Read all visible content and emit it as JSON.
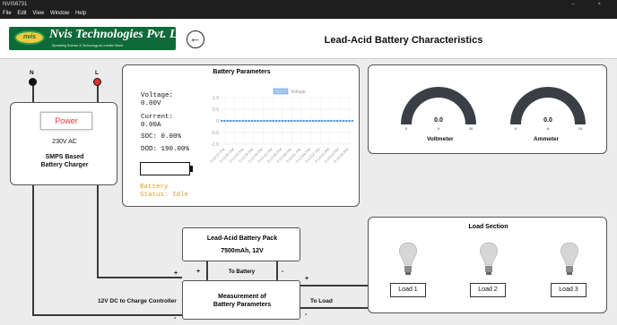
{
  "window": {
    "title": "NVIS6731",
    "controls": "–  ×"
  },
  "menu": [
    "File",
    "Edit",
    "View",
    "Window",
    "Help"
  ],
  "header": {
    "logo_mark": "nvis",
    "logo_name": "Nvis Technologies Pvt. Ltd.",
    "logo_tagline": "Spreading Science & Technology for a better World",
    "page_title": "Lead-Acid Battery Characteristics"
  },
  "terminals": {
    "neutral": "N",
    "live": "L"
  },
  "charger": {
    "power_label": "Power",
    "ac_label": "230V AC",
    "smps_line1": "SMPS Based",
    "smps_line2": "Battery Charger"
  },
  "battery_params": {
    "title": "Battery Parameters",
    "voltage_label": "Voltage:",
    "voltage_value": "0.00V",
    "current_label": "Current:",
    "current_value": "0.00A",
    "soc_label": "SOC:",
    "soc_value": "0.00%",
    "dod_label": "DOD:",
    "dod_value": "190.00%",
    "status_label": "Battery",
    "status_value": "Status: Idle"
  },
  "chart_data": {
    "type": "line",
    "legend": [
      "Voltage"
    ],
    "legend_position": "top-center",
    "ylim": [
      -1.0,
      1.0
    ],
    "yticks": [
      "1.0",
      "0.5",
      "0",
      "-0.5",
      "-1.0"
    ],
    "x": [
      "3:13:27 PM",
      "3:13:30 PM",
      "3:13:33 PM",
      "3:13:36 PM",
      "3:13:39 PM",
      "3:13:42 PM",
      "3:13:45 PM",
      "3:13:48 PM",
      "3:13:51 PM",
      "3:13:54 PM",
      "3:13:57 PM",
      "3:14:00 PM",
      "3:14:03 PM",
      "3:14:06 PM"
    ],
    "series": [
      {
        "name": "Voltage",
        "values": [
          0,
          0,
          0,
          0,
          0,
          0,
          0,
          0,
          0,
          0,
          0,
          0,
          0,
          0,
          0,
          0,
          0,
          0,
          0,
          0,
          0,
          0,
          0,
          0,
          0,
          0,
          0,
          0,
          0,
          0,
          0,
          0,
          0,
          0,
          0,
          0,
          0,
          0,
          0,
          0,
          0,
          0,
          0,
          0
        ]
      }
    ],
    "grid": true,
    "color": "#4a90d9"
  },
  "meters": {
    "voltmeter": {
      "value": "0.0",
      "unit": "V",
      "min": "0",
      "max": "20",
      "label": "Voltmeter",
      "level": 0
    },
    "ammeter": {
      "value": "0.0",
      "unit": "A",
      "min": "0",
      "max": "10",
      "label": "Ammeter",
      "level": 0
    }
  },
  "load_section": {
    "title": "Load Section",
    "loads": [
      "Load 1",
      "Load 2",
      "Load 3"
    ]
  },
  "battery_pack": {
    "name": "Lead-Acid Battery Pack",
    "capacity": "7500mAh, 12V"
  },
  "measurement": {
    "line1": "Measurement of",
    "line2": "Battery Parameters"
  },
  "wiring": {
    "to_battery": "To Battery",
    "to_load": "To Load",
    "dc_label": "12V DC to Charge Controller",
    "plus": "+",
    "minus": "-"
  },
  "colors": {
    "neutral_terminal": "#111111",
    "live_terminal": "#e03030",
    "power_text": "#e23a3a",
    "status_text": "#e89b1e"
  }
}
